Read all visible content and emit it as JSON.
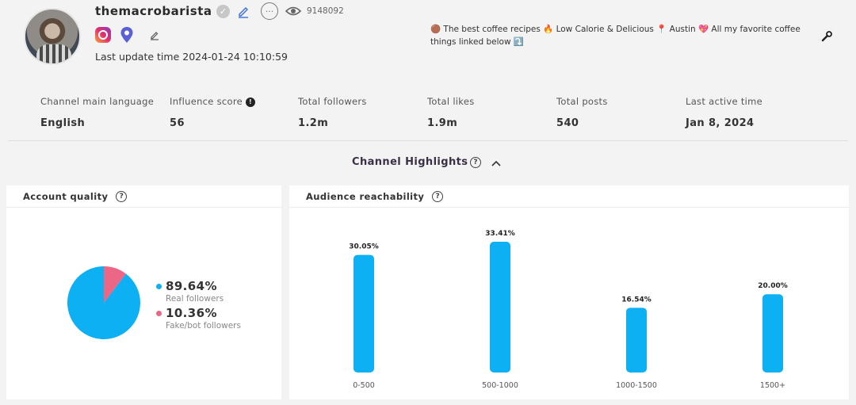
{
  "profile": {
    "username": "themacrobarista",
    "channel_id": "9148092",
    "last_update": "Last update time 2024-01-24 10:10:59",
    "bio": "🟤 The best coffee recipes 🔥 Low Calorie & Delicious 📍 Austin 💖 All my favorite coffee things linked below ⤵️"
  },
  "stats": [
    {
      "label": "Channel main language",
      "value": "English"
    },
    {
      "label": "Influence score",
      "value": "56"
    },
    {
      "label": "Total followers",
      "value": "1.2m"
    },
    {
      "label": "Total likes",
      "value": "1.9m"
    },
    {
      "label": "Total posts",
      "value": "540"
    },
    {
      "label": "Last active time",
      "value": "Jan 8, 2024"
    }
  ],
  "highlights_title": "Channel Highlights",
  "account_quality": {
    "title": "Account quality",
    "real_pct": "89.64%",
    "real_label": "Real followers",
    "fake_pct": "10.36%",
    "fake_label": "Fake/bot followers",
    "colors": {
      "real": "#0db0f3",
      "fake": "#ec6685"
    }
  },
  "audience": {
    "title": "Audience reachability"
  },
  "chart_data": [
    {
      "type": "pie",
      "categories": [
        "Real followers",
        "Fake/bot followers"
      ],
      "values": [
        89.64,
        10.36
      ]
    },
    {
      "type": "bar",
      "categories": [
        "0-500",
        "500-1000",
        "1000-1500",
        "1500+"
      ],
      "values": [
        30.05,
        33.41,
        16.54,
        20.0
      ],
      "data_labels": [
        "30.05%",
        "33.41%",
        "16.54%",
        "20.00%"
      ],
      "color": "#0db0f3"
    }
  ]
}
